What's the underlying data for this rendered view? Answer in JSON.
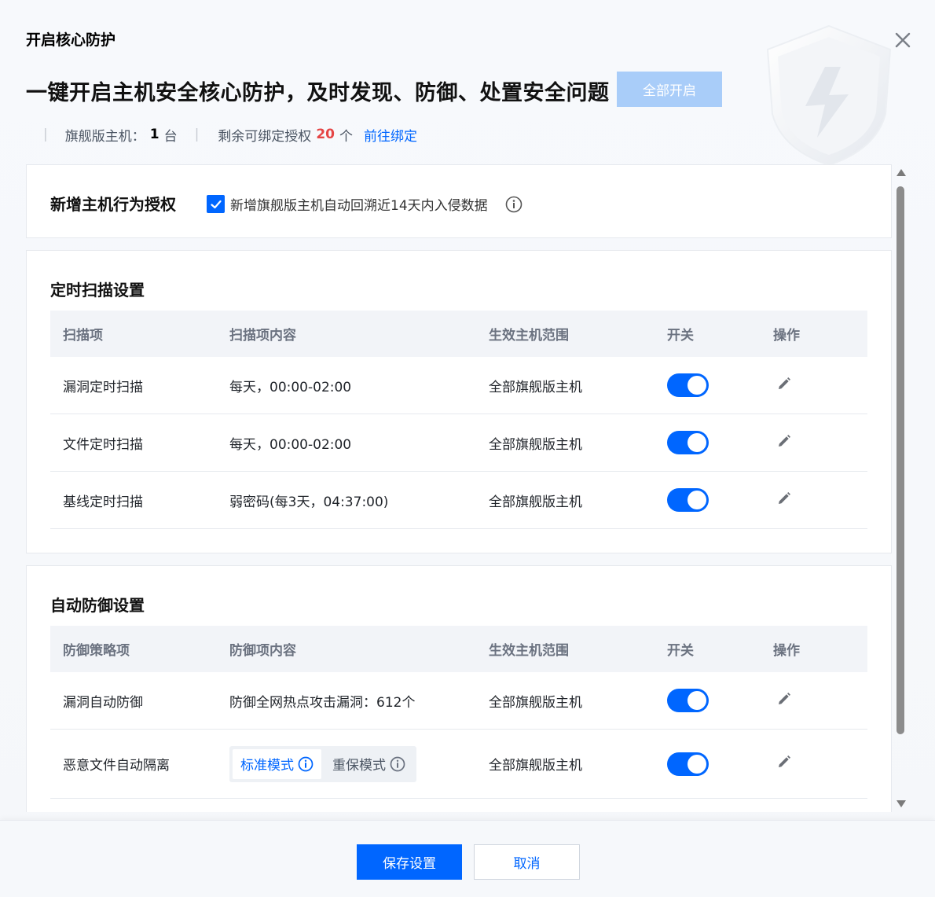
{
  "dialog": {
    "title": "开启核心防护",
    "headline": "一键开启主机安全核心防护，及时发现、防御、处置安全问题",
    "enable_all_label": "全部开启"
  },
  "stats": {
    "separator": "|",
    "flagship_label": "旗舰版主机：",
    "flagship_count": "1",
    "flagship_unit": "台",
    "remaining_label": "剩余可绑定授权",
    "remaining_count": "20",
    "remaining_unit": "个",
    "bind_link": "前往绑定"
  },
  "auth": {
    "label": "新增主机行为授权",
    "checkbox_label": "新增旗舰版主机自动回溯近14天内入侵数据",
    "checked": true
  },
  "scan": {
    "title": "定时扫描设置",
    "headers": [
      "扫描项",
      "扫描项内容",
      "生效主机范围",
      "开关",
      "操作"
    ],
    "rows": [
      {
        "item": "漏洞定时扫描",
        "content": "每天，00:00-02:00",
        "scope": "全部旗舰版主机",
        "enabled": true
      },
      {
        "item": "文件定时扫描",
        "content": "每天，00:00-02:00",
        "scope": "全部旗舰版主机",
        "enabled": true
      },
      {
        "item": "基线定时扫描",
        "content": "弱密码(每3天，04:37:00)",
        "scope": "全部旗舰版主机",
        "enabled": true
      }
    ]
  },
  "defense": {
    "title": "自动防御设置",
    "headers": [
      "防御策略项",
      "防御项内容",
      "生效主机范围",
      "开关",
      "操作"
    ],
    "rows": [
      {
        "item": "漏洞自动防御",
        "content": "防御全网热点攻击漏洞：612个",
        "scope": "全部旗舰版主机",
        "enabled": true
      },
      {
        "item": "恶意文件自动隔离",
        "mode_standard": "标准模式",
        "mode_heavy": "重保模式",
        "scope": "全部旗舰版主机",
        "enabled": true
      }
    ]
  },
  "footer": {
    "save_label": "保存设置",
    "cancel_label": "取消"
  },
  "colors": {
    "primary": "#0066ff",
    "primary_disabled": "#a9cdf9",
    "count_red": "#e54545"
  }
}
